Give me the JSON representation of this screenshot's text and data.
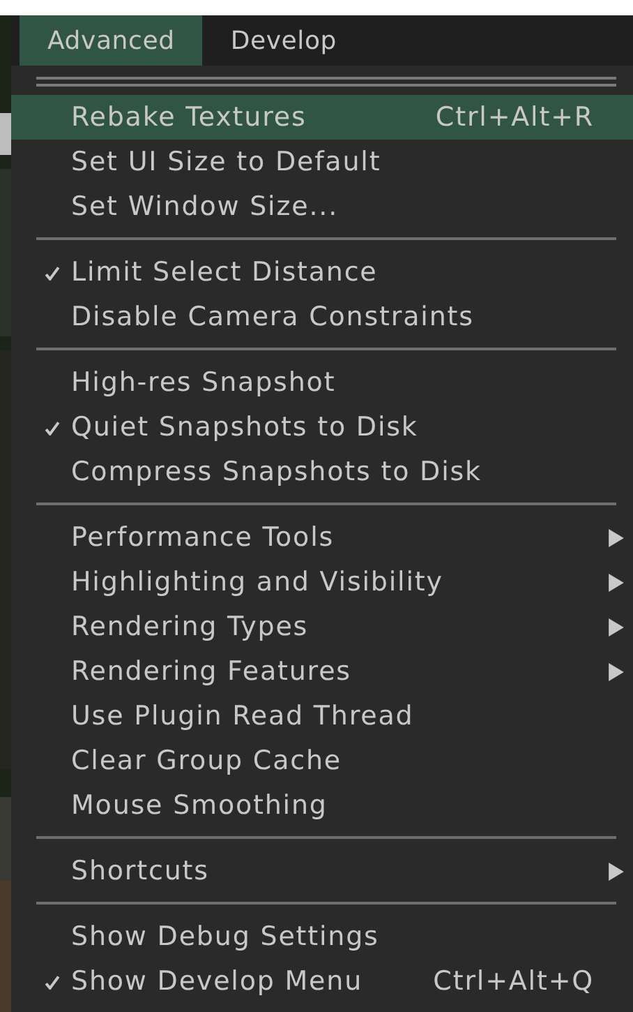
{
  "menubar": [
    {
      "label": "Advanced",
      "selected": true
    },
    {
      "label": "Develop",
      "selected": false
    }
  ],
  "menu": [
    {
      "kind": "item",
      "label": "Rebake Textures",
      "shortcut": "Ctrl+Alt+R",
      "selected": true,
      "checked": false,
      "submenu": false
    },
    {
      "kind": "item",
      "label": "Set UI Size to Default",
      "selected": false,
      "checked": false,
      "submenu": false
    },
    {
      "kind": "item",
      "label": "Set Window Size...",
      "selected": false,
      "checked": false,
      "submenu": false
    },
    {
      "kind": "separator"
    },
    {
      "kind": "item",
      "label": "Limit Select Distance",
      "selected": false,
      "checked": true,
      "submenu": false
    },
    {
      "kind": "item",
      "label": "Disable Camera Constraints",
      "selected": false,
      "checked": false,
      "submenu": false
    },
    {
      "kind": "separator"
    },
    {
      "kind": "item",
      "label": "High-res Snapshot",
      "selected": false,
      "checked": false,
      "submenu": false
    },
    {
      "kind": "item",
      "label": "Quiet Snapshots to Disk",
      "selected": false,
      "checked": true,
      "submenu": false
    },
    {
      "kind": "item",
      "label": "Compress Snapshots to Disk",
      "selected": false,
      "checked": false,
      "submenu": false
    },
    {
      "kind": "separator"
    },
    {
      "kind": "item",
      "label": "Performance Tools",
      "selected": false,
      "checked": false,
      "submenu": true
    },
    {
      "kind": "item",
      "label": "Highlighting and Visibility",
      "selected": false,
      "checked": false,
      "submenu": true
    },
    {
      "kind": "item",
      "label": "Rendering Types",
      "selected": false,
      "checked": false,
      "submenu": true
    },
    {
      "kind": "item",
      "label": "Rendering Features",
      "selected": false,
      "checked": false,
      "submenu": true
    },
    {
      "kind": "item",
      "label": "Use Plugin Read Thread",
      "selected": false,
      "checked": false,
      "submenu": false
    },
    {
      "kind": "item",
      "label": "Clear Group Cache",
      "selected": false,
      "checked": false,
      "submenu": false
    },
    {
      "kind": "item",
      "label": "Mouse Smoothing",
      "selected": false,
      "checked": false,
      "submenu": false
    },
    {
      "kind": "separator"
    },
    {
      "kind": "item",
      "label": "Shortcuts",
      "selected": false,
      "checked": false,
      "submenu": true
    },
    {
      "kind": "separator"
    },
    {
      "kind": "item",
      "label": "Show Debug Settings",
      "selected": false,
      "checked": false,
      "submenu": false
    },
    {
      "kind": "item",
      "label": "Show Develop Menu",
      "shortcut": "Ctrl+Alt+Q",
      "selected": false,
      "checked": true,
      "submenu": false
    }
  ]
}
